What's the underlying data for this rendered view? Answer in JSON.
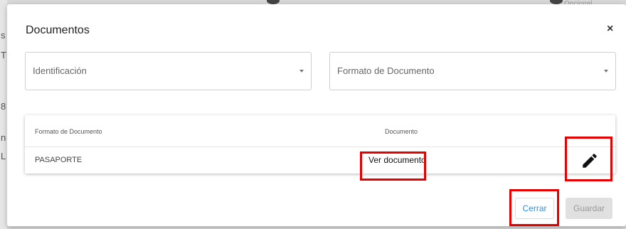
{
  "backdrop": {
    "left_chars": [
      "s",
      "T",
      "8",
      "n",
      "L"
    ],
    "opcional_label": "Opcional"
  },
  "dialog": {
    "title": "Documentos",
    "close_label": "×"
  },
  "filters": {
    "identificacion_placeholder": "Identificación",
    "formato_placeholder": "Formato de Documento"
  },
  "table": {
    "columns": [
      "Formato de Documento",
      "Documento"
    ],
    "rows": [
      {
        "formato": "PASAPORTE",
        "documento_link": "Ver documento",
        "action_icon": "pencil-icon"
      }
    ]
  },
  "footer": {
    "cerrar_label": "Cerrar",
    "guardar_label": "Guardar"
  },
  "colors": {
    "highlight": "#e60000",
    "accent": "#2196f3",
    "disabled_bg": "#e0e0e0"
  }
}
